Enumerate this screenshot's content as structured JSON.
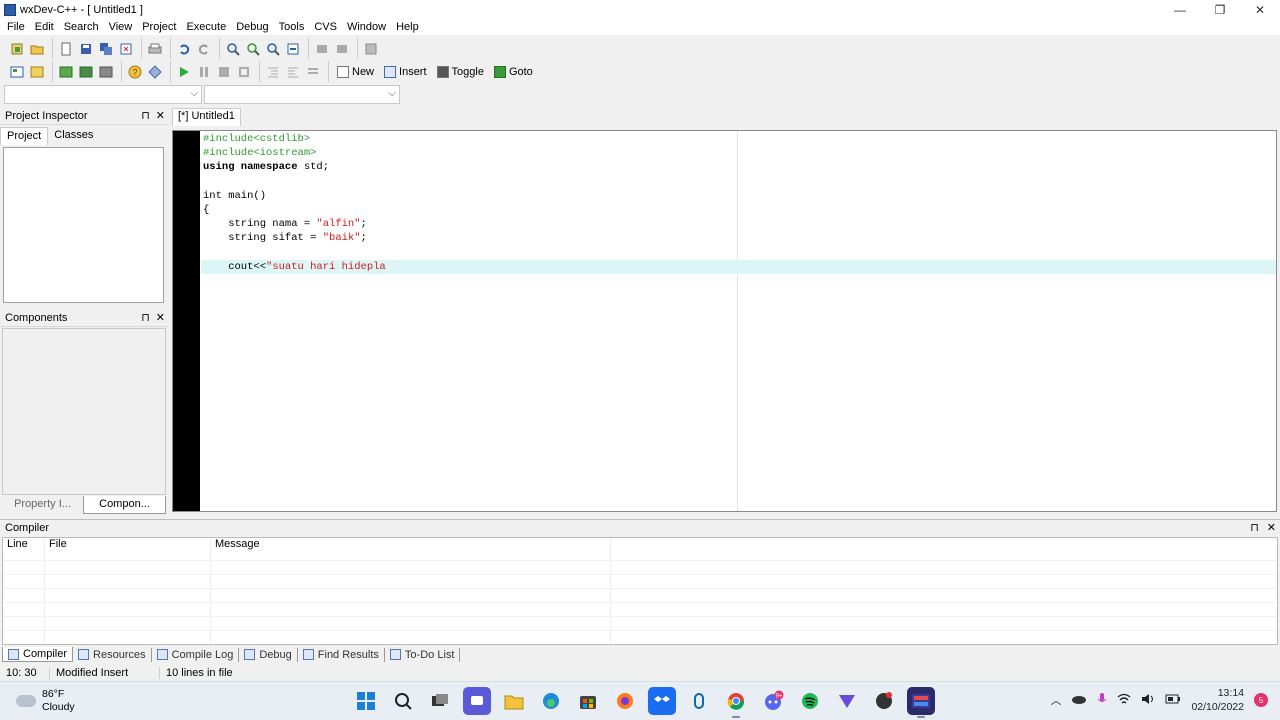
{
  "window": {
    "title": "wxDev-C++ - [ Untitled1 ]",
    "minimize": "—",
    "restore": "❐",
    "close": "✕"
  },
  "menu": [
    "File",
    "Edit",
    "Search",
    "View",
    "Project",
    "Execute",
    "Debug",
    "Tools",
    "CVS",
    "Window",
    "Help"
  ],
  "toolbar2": {
    "new_label": "New",
    "insert_label": "Insert",
    "toggle_label": "Toggle",
    "goto_label": "Goto"
  },
  "project_inspector": {
    "title": "Project Inspector",
    "tab_project": "Project",
    "tab_classes": "Classes",
    "pin": "⊓",
    "close": "✕"
  },
  "components": {
    "title": "Components",
    "pin": "⊓",
    "close": "✕"
  },
  "left_tabs": {
    "property": "Property I...",
    "components": "Compon..."
  },
  "editor": {
    "tab_label": "[*] Untitled1",
    "lines": [
      {
        "type": "pp",
        "text": "#include<cstdlib>"
      },
      {
        "type": "pp",
        "text": "#include<iostream>"
      },
      {
        "type": "ns",
        "kw": "using namespace",
        "text": " std;"
      },
      {
        "type": "plain",
        "text": ""
      },
      {
        "type": "plain",
        "text": "int main()"
      },
      {
        "type": "plain",
        "text": "{"
      },
      {
        "type": "str",
        "pre": "    string nama = ",
        "str": "\"alfin\"",
        "post": ";"
      },
      {
        "type": "str",
        "pre": "    string sifat = ",
        "str": "\"baik\"",
        "post": ";"
      },
      {
        "type": "plain",
        "text": ""
      },
      {
        "type": "str_active",
        "pre": "    cout<<",
        "str": "\"suatu hari hidepla",
        "post": ""
      }
    ]
  },
  "compiler": {
    "title": "Compiler",
    "columns": [
      "Line",
      "File",
      "Message"
    ],
    "pin": "⊓",
    "close": "✕"
  },
  "bottom_tabs": [
    "Compiler",
    "Resources",
    "Compile Log",
    "Debug",
    "Find Results",
    "To-Do List"
  ],
  "status": {
    "position": "10: 30",
    "mode": "Modified Insert",
    "lines": "10 lines in file"
  },
  "taskbar": {
    "weather_temp": "86°F",
    "weather_desc": "Cloudy",
    "time": "13:14",
    "date": "02/10/2022",
    "discord_badge": "9+",
    "notif": "5"
  }
}
